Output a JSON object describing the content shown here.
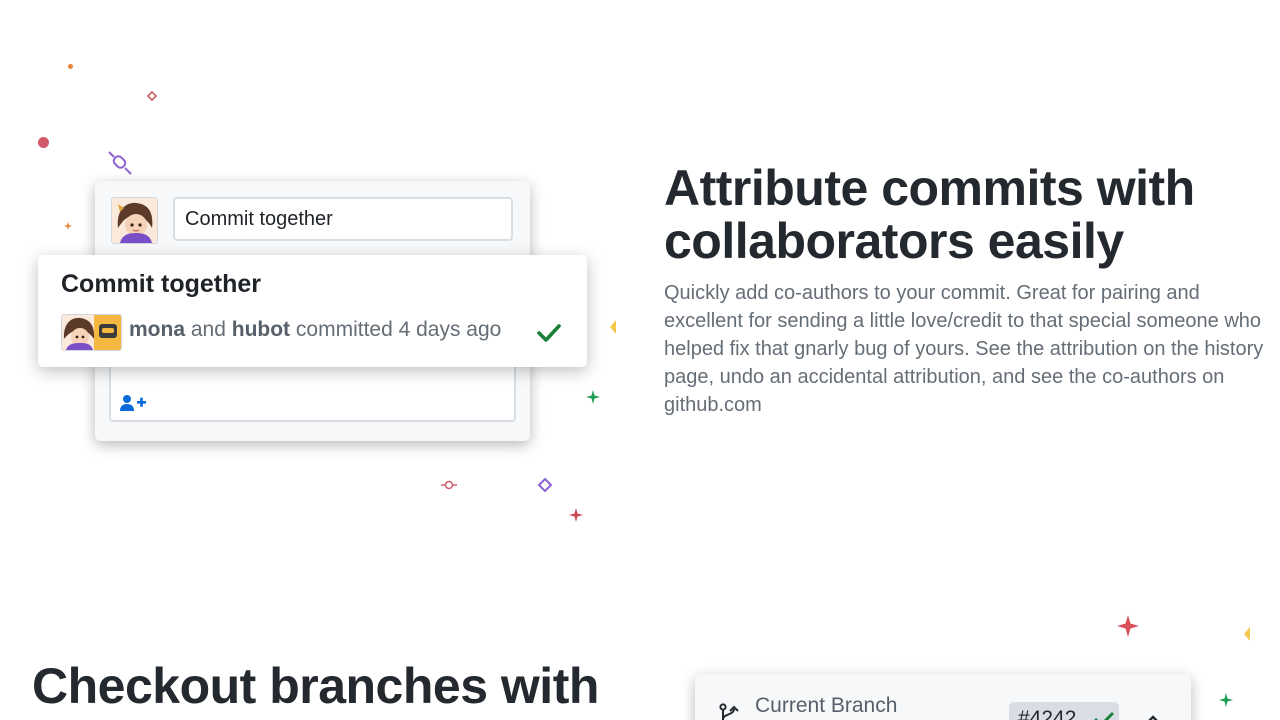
{
  "feature_coauthors": {
    "commit_form": {
      "summary_value": "Commit together",
      "add_coauthor_icon": "person-add-icon"
    },
    "commit_item": {
      "title": "Commit together",
      "author_1": "mona",
      "connector": "and",
      "author_2": "hubot",
      "suffix": "committed 4 days ago",
      "status_icon": "check-icon"
    },
    "headline": "Attribute commits with collaborators easily",
    "description": "Quickly add co-authors to your commit. Great for pairing and excellent for sending a little love/credit to that special someone who helped fix that gnarly bug of yours. See the attribution on the history page, undo an accidental attribution, and see the co-authors on github.com"
  },
  "feature_branches": {
    "headline": "Checkout branches with",
    "branch_card": {
      "label": "Current Branch",
      "pr_number": "#4242",
      "branch_icon": "git-branch-icon"
    }
  },
  "colors": {
    "headline": "#24292f",
    "body_text": "#656d76",
    "success_green": "#1a7f37",
    "link_blue": "#0969da",
    "card_bg": "#f6f8fa"
  }
}
